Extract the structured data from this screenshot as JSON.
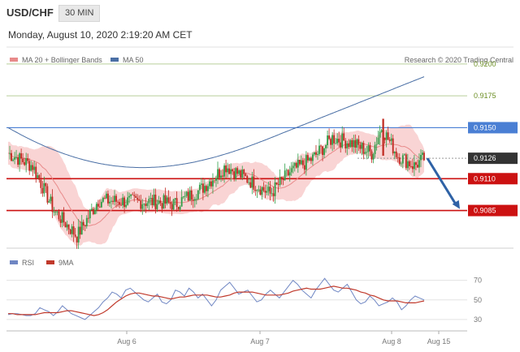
{
  "header": {
    "pair": "USD/CHF",
    "timeframe": "30 MIN",
    "datetime": "Monday, August 10, 2020 2:19:20 AM CET"
  },
  "legend": {
    "ma20_bb": "MA 20 + Bollinger Bands",
    "ma50": "MA 50",
    "credit": "Research © 2020 Trading Central",
    "rsi": "RSI",
    "ma9": "9MA"
  },
  "colors": {
    "resistance": "#4a7fd4",
    "support": "#cc1111",
    "target": "#6b8e23",
    "current": "#333333",
    "bands": "#f7c5c5",
    "ma20": "#e88a8a",
    "ma50": "#4a6fa5",
    "arrow": "#2f62a6",
    "rsi": "#6f86c3",
    "ma9": "#c0392b"
  },
  "chart_data": [
    {
      "type": "candlestick",
      "ylim": [
        0.9058,
        0.9212
      ],
      "x_ticks": [
        "Aug 6",
        "Aug 7",
        "Aug 8",
        "Aug 15"
      ],
      "y_ticks": [
        {
          "value": 0.92,
          "label": "0.9200",
          "kind": "target"
        },
        {
          "value": 0.9175,
          "label": "0.9175",
          "kind": "target"
        },
        {
          "value": 0.915,
          "label": "0.9150",
          "kind": "resistance"
        },
        {
          "value": 0.9126,
          "label": "0.9126",
          "kind": "current"
        },
        {
          "value": 0.911,
          "label": "0.9110",
          "kind": "support"
        },
        {
          "value": 0.9085,
          "label": "0.9085",
          "kind": "support"
        }
      ],
      "forecast": {
        "from": 0.9126,
        "to": 0.9085
      }
    },
    {
      "type": "line",
      "name": "RSI",
      "ylim": [
        20,
        78
      ],
      "y_ticks": [
        "70",
        "50",
        "30"
      ],
      "series": [
        {
          "name": "RSI",
          "values": [
            35,
            36,
            36,
            35,
            34,
            34,
            36,
            42,
            40,
            38,
            34,
            38,
            44,
            40,
            36,
            34,
            32,
            30,
            34,
            38,
            42,
            48,
            52,
            58,
            56,
            52,
            60,
            62,
            58,
            54,
            50,
            48,
            52,
            56,
            48,
            46,
            50,
            60,
            58,
            54,
            62,
            58,
            52,
            56,
            50,
            44,
            50,
            60,
            64,
            68,
            62,
            56,
            58,
            60,
            54,
            48,
            50,
            56,
            60,
            56,
            52,
            58,
            64,
            70,
            66,
            60,
            56,
            52,
            60,
            66,
            72,
            66,
            60,
            58,
            62,
            66,
            58,
            50,
            46,
            48,
            54,
            50,
            44,
            46,
            48,
            52,
            48,
            40,
            44,
            50,
            54,
            52,
            50
          ]
        },
        {
          "name": "9MA",
          "values": [
            36,
            36,
            35,
            35,
            35,
            35,
            35,
            36,
            37,
            37,
            37,
            37,
            38,
            39,
            39,
            38,
            37,
            36,
            35,
            34,
            35,
            37,
            40,
            44,
            48,
            51,
            54,
            56,
            57,
            57,
            56,
            55,
            54,
            54,
            53,
            52,
            51,
            52,
            53,
            53,
            54,
            55,
            55,
            55,
            55,
            54,
            53,
            53,
            54,
            55,
            57,
            58,
            58,
            58,
            58,
            57,
            56,
            55,
            55,
            55,
            55,
            56,
            57,
            59,
            60,
            61,
            62,
            61,
            61,
            61,
            62,
            63,
            64,
            63,
            62,
            62,
            61,
            60,
            58,
            57,
            55,
            54,
            52,
            50,
            49,
            49,
            49,
            48,
            47,
            47,
            47,
            48,
            49
          ]
        }
      ]
    }
  ]
}
